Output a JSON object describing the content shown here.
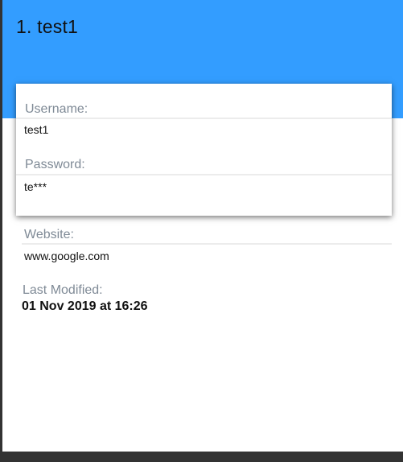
{
  "header": {
    "title": "1. test1",
    "background_color": "#339dff"
  },
  "fields": {
    "username": {
      "label": "Username:",
      "value": "test1"
    },
    "password": {
      "label": "Password:",
      "value": "te***"
    },
    "website": {
      "label": "Website:",
      "value": "www.google.com"
    },
    "last_modified": {
      "label": "Last Modified:",
      "value": "01 Nov 2019 at 16:26"
    }
  },
  "colors": {
    "label": "#7f8a96",
    "value": "#111111",
    "frame": "#333333"
  }
}
